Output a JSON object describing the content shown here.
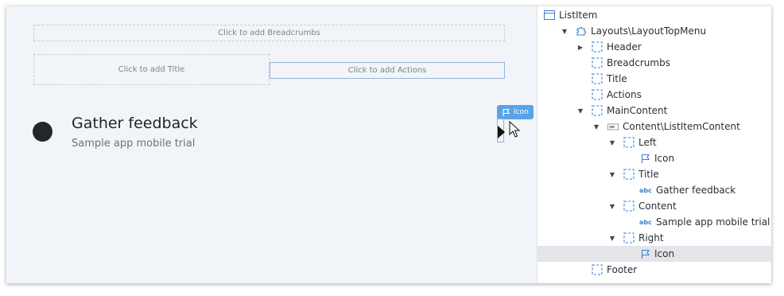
{
  "canvas": {
    "breadcrumbs_placeholder": "Click to add Breadcrumbs",
    "title_placeholder": "Click to add Title",
    "actions_placeholder": "Click to add Actions",
    "list_item": {
      "title": "Gather feedback",
      "subtitle": "Sample app mobile trial"
    },
    "selection_badge": "Icon"
  },
  "tree": {
    "items": [
      {
        "label": "ListItem",
        "icon": "window-icon",
        "depth": 0,
        "toggle": "none"
      },
      {
        "label": "Layouts\\LayoutTopMenu",
        "icon": "puzzle-icon",
        "depth": 1,
        "toggle": "expanded"
      },
      {
        "label": "Header",
        "icon": "placeholder-icon",
        "depth": 2,
        "toggle": "collapsed"
      },
      {
        "label": "Breadcrumbs",
        "icon": "placeholder-icon",
        "depth": 2,
        "toggle": "none"
      },
      {
        "label": "Title",
        "icon": "placeholder-icon",
        "depth": 2,
        "toggle": "none"
      },
      {
        "label": "Actions",
        "icon": "placeholder-icon",
        "depth": 2,
        "toggle": "none"
      },
      {
        "label": "MainContent",
        "icon": "placeholder-icon",
        "depth": 2,
        "toggle": "expanded"
      },
      {
        "label": "Content\\ListItemContent",
        "icon": "block-icon",
        "depth": 3,
        "toggle": "expanded"
      },
      {
        "label": "Left",
        "icon": "placeholder-icon",
        "depth": 4,
        "toggle": "expanded"
      },
      {
        "label": "Icon",
        "icon": "flag-icon",
        "depth": 5,
        "toggle": "none"
      },
      {
        "label": "Title",
        "icon": "placeholder-icon",
        "depth": 4,
        "toggle": "expanded"
      },
      {
        "label": "Gather feedback",
        "icon": "abc-icon",
        "depth": 5,
        "toggle": "none"
      },
      {
        "label": "Content",
        "icon": "placeholder-icon",
        "depth": 4,
        "toggle": "expanded"
      },
      {
        "label": "Sample app mobile trial",
        "icon": "abc-icon",
        "depth": 5,
        "toggle": "none"
      },
      {
        "label": "Right",
        "icon": "placeholder-icon",
        "depth": 4,
        "toggle": "expanded"
      },
      {
        "label": "Icon",
        "icon": "flag-icon",
        "depth": 5,
        "toggle": "none",
        "selected": true
      },
      {
        "label": "Footer",
        "icon": "placeholder-icon",
        "depth": 2,
        "toggle": "none"
      }
    ]
  }
}
